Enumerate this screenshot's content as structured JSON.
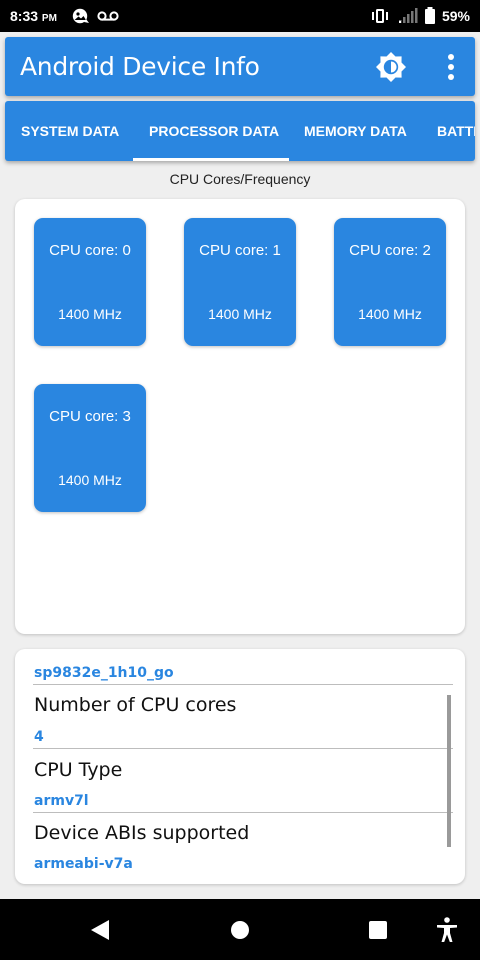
{
  "status_bar": {
    "time": "8:33",
    "ampm": "PM",
    "battery_percent": "59%",
    "icons": [
      "photo-icon",
      "voicemail-icon",
      "vibrate-icon",
      "signal-icon",
      "battery-icon"
    ]
  },
  "app_bar": {
    "title": "Android Device Info",
    "icons": [
      "brightness-icon",
      "more-vert-icon"
    ],
    "color": "#2a86e0"
  },
  "tabs": [
    {
      "label": "SYSTEM DATA",
      "selected": false
    },
    {
      "label": "PROCESSOR DATA",
      "selected": true
    },
    {
      "label": "MEMORY DATA",
      "selected": false
    },
    {
      "label": "BATTERY DATA",
      "selected": false
    }
  ],
  "cores_section": {
    "caption": "CPU Cores/Frequency",
    "cores": [
      {
        "name": "CPU core: 0",
        "frequency": "1400 MHz"
      },
      {
        "name": "CPU core: 1",
        "frequency": "1400 MHz"
      },
      {
        "name": "CPU core: 2",
        "frequency": "1400 MHz"
      },
      {
        "name": "CPU core: 3",
        "frequency": "1400 MHz"
      }
    ]
  },
  "processor_info": {
    "chipset": "sp9832e_1h10_go",
    "rows": [
      {
        "label": "Number of CPU cores",
        "value": "4"
      },
      {
        "label": "CPU Type",
        "value": "armv7l"
      },
      {
        "label": "Device ABIs supported",
        "value": "armeabi-v7a"
      }
    ]
  },
  "nav_bar": {
    "icons": [
      "back-icon",
      "home-icon",
      "recents-icon",
      "accessibility-icon"
    ]
  }
}
